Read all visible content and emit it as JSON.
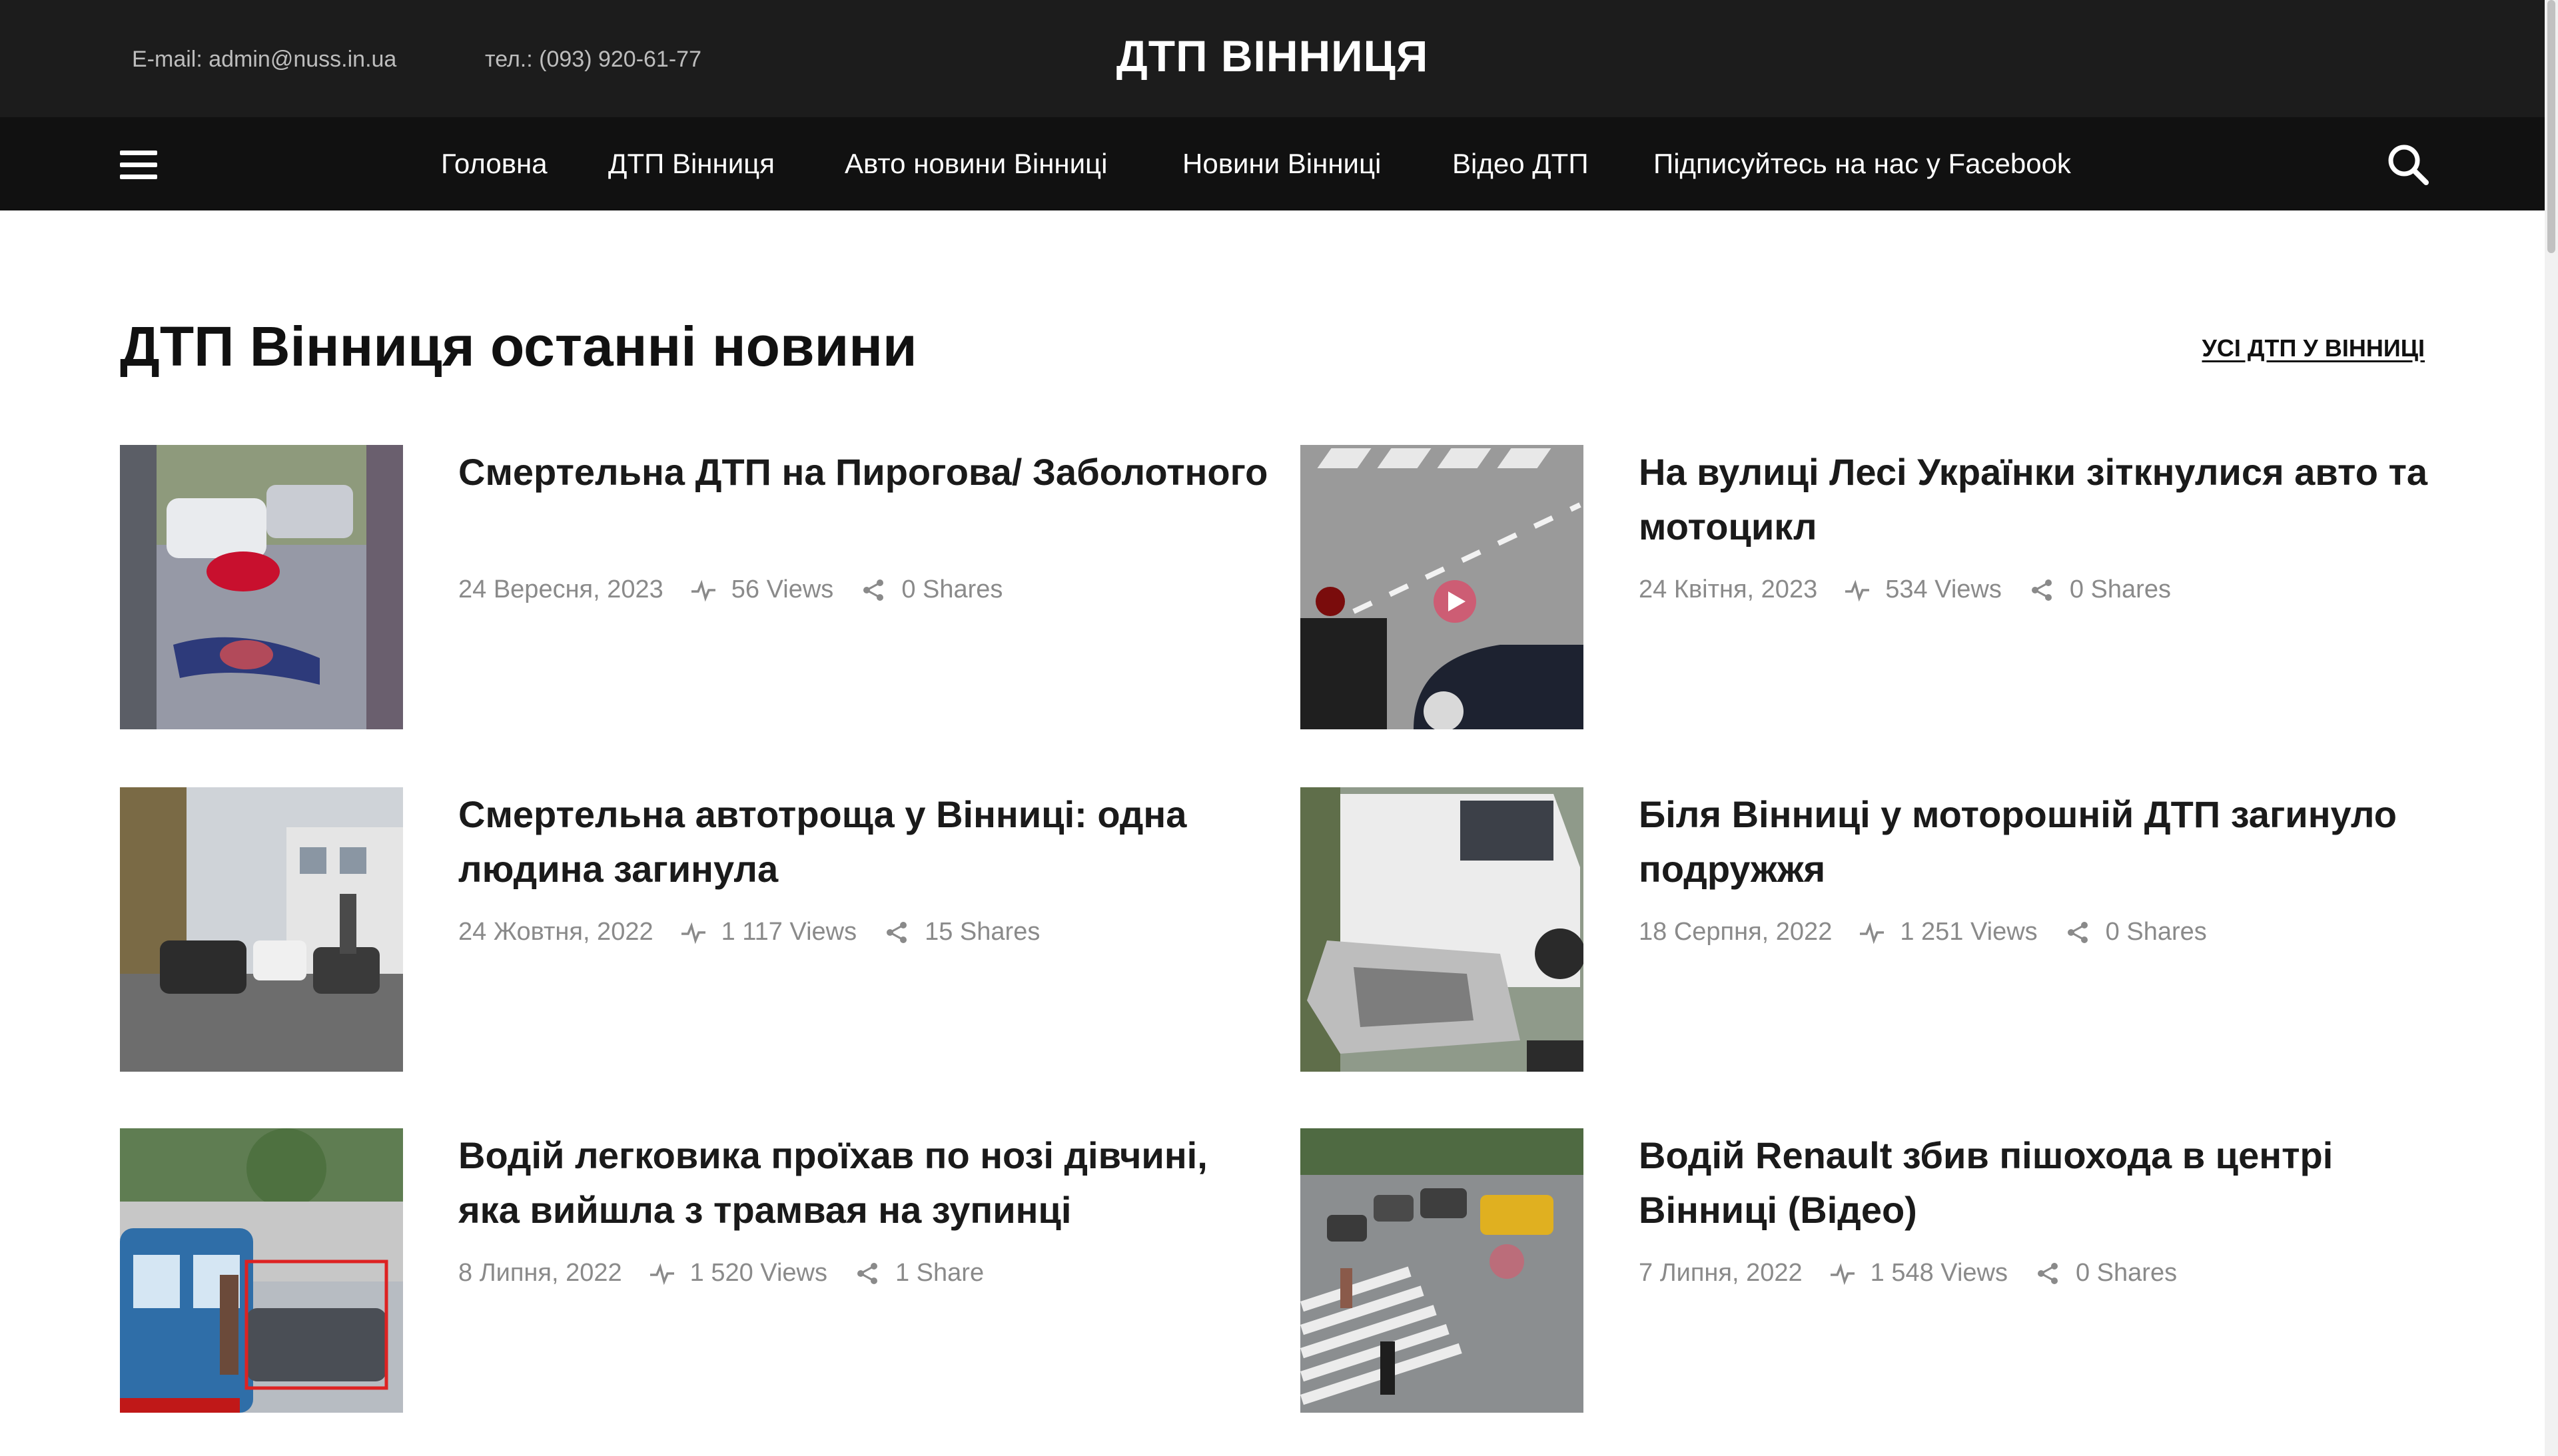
{
  "topbar": {
    "email": "E-mail: admin@nuss.in.ua",
    "phone": "тел.: (093) 920-61-77",
    "site_title": "ДТП ВІННИЦЯ"
  },
  "nav": {
    "items": [
      {
        "label": "Головна"
      },
      {
        "label": "ДТП Вінниця"
      },
      {
        "label": "Авто новини Вінниці"
      },
      {
        "label": "Новини Вінниці"
      },
      {
        "label": "Відео ДТП"
      },
      {
        "label": "Підписуйтесь на нас у Facebook"
      }
    ],
    "menu_icon": "hamburger-menu-icon",
    "search_icon": "search-icon"
  },
  "section": {
    "title": "ДТП Вінниця останні новини",
    "all_link": "УСІ ДТП У ВІННИЦІ"
  },
  "articles": [
    {
      "title": "Смертельна ДТП на Пирогова/ Заболотного",
      "date": "24 Вересня, 2023",
      "views": "56 Views",
      "shares": "0 Shares"
    },
    {
      "title": "На вулиці Лесі Українки зіткнулися авто та мотоцикл",
      "date": "24 Квітня, 2023",
      "views": "534 Views",
      "shares": "0 Shares"
    },
    {
      "title": "Смертельна автотроща у Вінниці: одна людина загинула",
      "date": "24 Жовтня, 2022",
      "views": "1 117 Views",
      "shares": "15 Shares"
    },
    {
      "title": "Біля Вінниці у моторошній ДТП загинуло подружжя",
      "date": "18 Серпня, 2022",
      "views": "1 251 Views",
      "shares": "0 Shares"
    },
    {
      "title": "Водій легковика проїхав по нозі дівчині, яка вийшла з трамвая на зупинці",
      "date": "8 Липня, 2022",
      "views": "1 520 Views",
      "shares": "1 Share"
    },
    {
      "title": "Водій Renault збив пішохода в центрі Вінниці (Відео)",
      "date": "7 Липня, 2022",
      "views": "1 548 Views",
      "shares": "0 Shares"
    }
  ],
  "colors": {
    "topbar_bg": "#1c1c1c",
    "navbar_bg": "#111111",
    "meta_text": "#8a8a8a"
  }
}
